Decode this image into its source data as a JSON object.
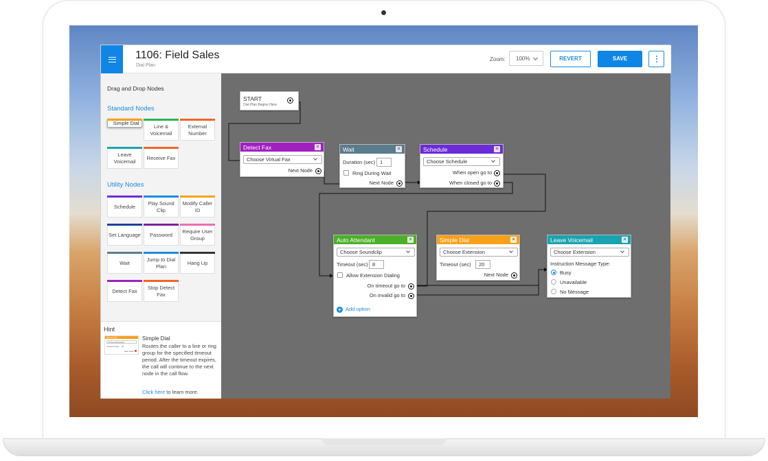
{
  "header": {
    "title": "1106: Field Sales",
    "subtitle": "Dial Plan",
    "zoom_label": "Zoom:",
    "zoom_value": "100%",
    "revert_label": "REVERT",
    "save_label": "SAVE"
  },
  "sidebar": {
    "heading": "Drag and Drop Nodes",
    "standard_title": "Standard Nodes",
    "standard_nodes": [
      {
        "label": "Simple Dial",
        "color": "#f7a11a"
      },
      {
        "label": "Line & Voicemail",
        "color": "#2bb24c"
      },
      {
        "label": "External Number",
        "color": "#f26522"
      },
      {
        "label": "Leave Voicemail",
        "color": "#1aa3b0"
      },
      {
        "label": "Receive Fax",
        "color": "#f26522"
      }
    ],
    "utility_title": "Utility Nodes",
    "utility_nodes": [
      {
        "label": "Schedule",
        "color": "#6c2bd9"
      },
      {
        "label": "Play Sound Clip",
        "color": "#1a8be0"
      },
      {
        "label": "Modify Caller ID",
        "color": "#f7a11a"
      },
      {
        "label": "Set Language",
        "color": "#1a3fa0"
      },
      {
        "label": "Password",
        "color": "#7a1fa2"
      },
      {
        "label": "Require User Group",
        "color": "#f06bb0"
      },
      {
        "label": "Wait",
        "color": "#5b7c8d"
      },
      {
        "label": "Jump to Dial Plan",
        "color": "#1a8be0"
      },
      {
        "label": "Hang Up",
        "color": "#333333"
      },
      {
        "label": "Detect Fax",
        "color": "#a020c0"
      },
      {
        "label": "Stop Detect Fax",
        "color": "#f26522"
      }
    ]
  },
  "hint": {
    "title": "Hint",
    "node_name": "Simple Dial",
    "text": "Routes the caller to a line or ring group for the specified timeout period. After the timeout expires, the call will continue to the next node in the call flow.",
    "link_text": "Click here",
    "link_suffix": " to learn more.",
    "preview": {
      "header": "Simple Dial",
      "select": "Choose Extension",
      "timeout_label": "Timeout (sec)",
      "timeout_value": "20",
      "next": "Next Node"
    }
  },
  "canvas": {
    "start": {
      "title": "START",
      "subtitle": "Dial Plan Begins Here"
    },
    "detect_fax": {
      "title": "Detect Fax",
      "color": "#a020c0",
      "select": "Choose Virtual Fax",
      "next": "Next Node"
    },
    "wait": {
      "title": "Wait",
      "color": "#5b7c8d",
      "duration_label": "Duration (sec)",
      "duration_value": "1",
      "ring_label": "Ring During Wait",
      "next": "Next Node"
    },
    "schedule": {
      "title": "Schedule",
      "color": "#6c2bd9",
      "select": "Choose Schedule",
      "open": "When open go to",
      "closed": "When closed go to"
    },
    "auto_attendant": {
      "title": "Auto Attendant",
      "color": "#4caf2a",
      "select": "Choose Soundclip",
      "timeout_label": "Timeout (sec)",
      "timeout_value": "8",
      "allow_label": "Allow Extension Dialing",
      "on_timeout": "On timeout go to",
      "on_invalid": "On invalid go to",
      "add_option": "Add option"
    },
    "simple_dial": {
      "title": "Simple Dial",
      "color": "#f7a11a",
      "select": "Choose Extension",
      "timeout_label": "Timeout (sec)",
      "timeout_value": "20",
      "next": "Next Node"
    },
    "leave_voicemail": {
      "title": "Leave Voicemail",
      "color": "#1aa3b0",
      "select": "Choose Extension",
      "instruction_label": "Instruction Message Type:",
      "options": [
        "Busy",
        "Unavailable",
        "No Message"
      ],
      "selected": "Busy"
    }
  }
}
